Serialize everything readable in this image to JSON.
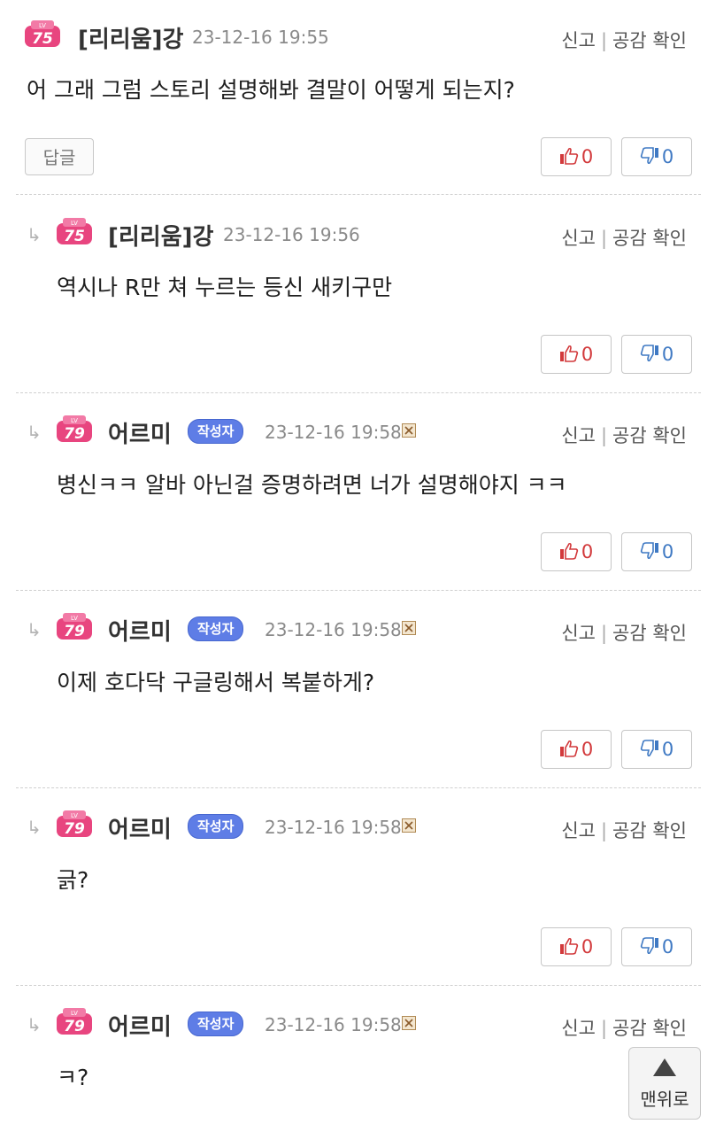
{
  "actions": {
    "report": "신고",
    "separator": "|",
    "likes_check": "공감 확인"
  },
  "reply_button": "답글",
  "author_badge": "작성자",
  "top_button": "맨위로",
  "comments": [
    {
      "level": "75",
      "nick": "[리리움]강",
      "date": "23-12-16 19:55",
      "text": "어 그래 그럼 스토리 설명해봐 결말이 어떻게 되는지?",
      "up": "0",
      "down": "0"
    },
    {
      "level": "75",
      "nick": "[리리움]강",
      "date": "23-12-16 19:56",
      "text": "역시나 R만 쳐 누르는 등신 새키구만",
      "up": "0",
      "down": "0"
    },
    {
      "level": "79",
      "nick": "어르미",
      "date": "23-12-16 19:58",
      "text": "병신ㅋㅋ 알바 아닌걸 증명하려면 너가 설명해야지 ㅋㅋ",
      "up": "0",
      "down": "0"
    },
    {
      "level": "79",
      "nick": "어르미",
      "date": "23-12-16 19:58",
      "text": "이제 호다닥 구글링해서 복붙하게?",
      "up": "0",
      "down": "0"
    },
    {
      "level": "79",
      "nick": "어르미",
      "date": "23-12-16 19:58",
      "text": "긁?",
      "up": "0",
      "down": "0"
    },
    {
      "level": "79",
      "nick": "어르미",
      "date": "23-12-16 19:58",
      "text": "ㅋ?"
    }
  ],
  "colors": {
    "like": "#d2393b",
    "dislike": "#3f79c3",
    "badge": "#5e7de6",
    "level_pink": "#e8457f"
  }
}
